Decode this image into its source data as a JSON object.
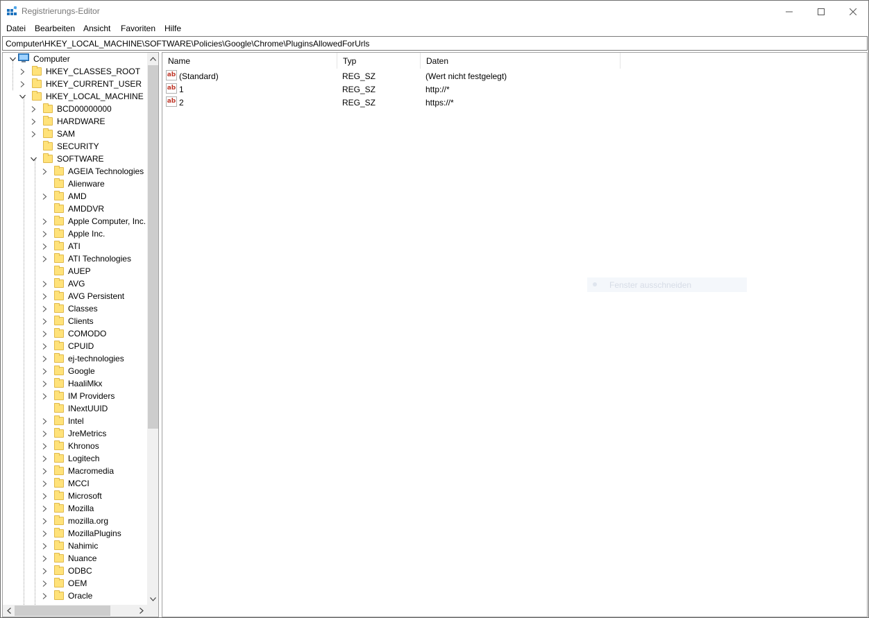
{
  "window": {
    "title": "Registrierungs-Editor"
  },
  "menu": [
    "Datei",
    "Bearbeiten",
    "Ansicht",
    "Favoriten",
    "Hilfe"
  ],
  "address": "Computer\\HKEY_LOCAL_MACHINE\\SOFTWARE\\Policies\\Google\\Chrome\\PluginsAllowedForUrls",
  "tree": {
    "root": "Computer",
    "hives": [
      "HKEY_CLASSES_ROOT",
      "HKEY_CURRENT_USER",
      "HKEY_LOCAL_MACHINE"
    ],
    "hklm_children": [
      "BCD00000000",
      "HARDWARE",
      "SAM",
      "SECURITY",
      "SOFTWARE"
    ],
    "software_children": [
      "AGEIA Technologies",
      "Alienware",
      "AMD",
      "AMDDVR",
      "Apple Computer, Inc.",
      "Apple Inc.",
      "ATI",
      "ATI Technologies",
      "AUEP",
      "AVG",
      "AVG Persistent",
      "Classes",
      "Clients",
      "COMODO",
      "CPUID",
      "ej-technologies",
      "Google",
      "HaaliMkx",
      "IM Providers",
      "INextUUID",
      "Intel",
      "JreMetrics",
      "Khronos",
      "Logitech",
      "Macromedia",
      "MCCI",
      "Microsoft",
      "Mozilla",
      "mozilla.org",
      "MozillaPlugins",
      "Nahimic",
      "Nuance",
      "ODBC",
      "OEM",
      "Oracle"
    ]
  },
  "list": {
    "columns": [
      "Name",
      "Typ",
      "Daten"
    ],
    "rows": [
      {
        "name": "(Standard)",
        "type": "REG_SZ",
        "data": "(Wert nicht festgelegt)"
      },
      {
        "name": "1",
        "type": "REG_SZ",
        "data": "http://*"
      },
      {
        "name": "2",
        "type": "REG_SZ",
        "data": "https://*"
      }
    ],
    "value_icon": "ab"
  },
  "ghost_tooltip": "Fenster ausschneiden"
}
